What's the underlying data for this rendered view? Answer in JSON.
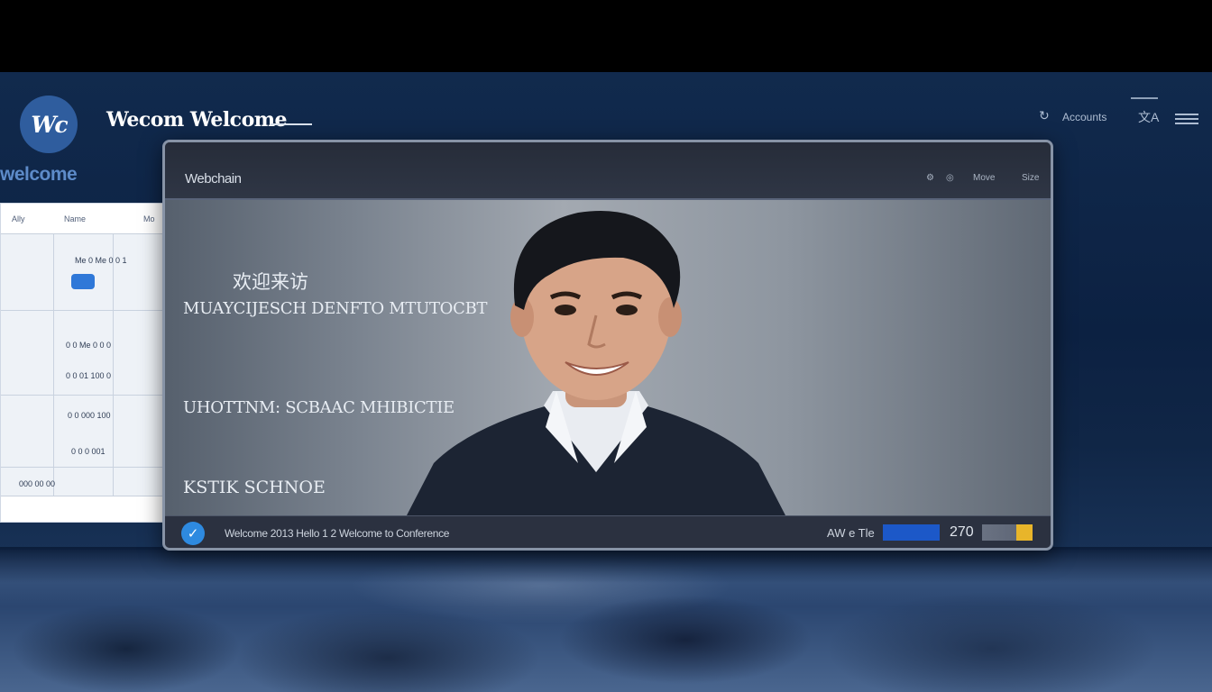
{
  "header": {
    "logo_text": "Wc",
    "title": "Wecom Welcome",
    "subtitle": "welcome",
    "right_text": "Accounts"
  },
  "sheet": {
    "headers": [
      "Ally",
      "Name",
      "Mo"
    ],
    "rows": [
      "Me 0 Me 0 0 1",
      "0 0 Me 0 0 0",
      "0 0 01 100 0",
      "0 0 000 100",
      "0 0 0 001",
      "000 00 00"
    ]
  },
  "window": {
    "title": "Webchain",
    "controls": [
      "⚙",
      "◎",
      "Move",
      "Size"
    ]
  },
  "video": {
    "captions": [
      "欢迎来访",
      "MUAYCIJESCH DENFTO MTUTOCBT",
      "UHOTTNM: SCBAAC MHIBICTIE",
      "KSTIK SCHNOE"
    ]
  },
  "call_bar": {
    "info": "Welcome 2013 Hello 1 2 Welcome to Conference",
    "label": "AW e Tle",
    "count": "270",
    "level": 0.68
  },
  "colors": {
    "accent": "#2e8ae0",
    "level_bar": "#1c58c8",
    "meter_accent": "#e8b52a"
  }
}
